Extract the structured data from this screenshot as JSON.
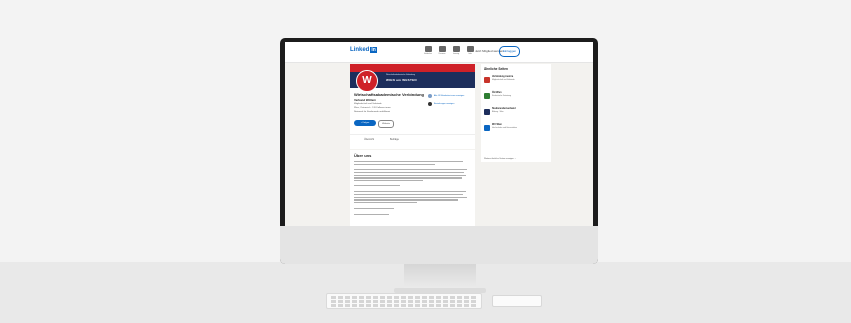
{
  "app": {
    "logo_text": "Linked",
    "logo_in": "in",
    "join_label": "Jetzt Mitglied werden",
    "signin_label": "Einloggen",
    "nav": [
      {
        "label": "Entdecken",
        "icon": "compass-icon"
      },
      {
        "label": "Personen",
        "icon": "people-icon"
      },
      {
        "label": "Learning",
        "icon": "play-icon"
      },
      {
        "label": "Jobs",
        "icon": "briefcase-icon"
      }
    ]
  },
  "company": {
    "banner_top": "Wirtschaftsakademische Verbindung",
    "banner_title": "WIEN am WESTEN",
    "emblem": "W",
    "name": "Wirtschaftsakademische Verbindung",
    "subtitle": "Verband Wöllern",
    "lines": [
      "Mitgliedschaft und Verbände",
      "Wien, Österreich  ·  120 Follower:innen",
      "Netzwerk für Studierende und Alumni"
    ],
    "follow_label": "+ Folgen",
    "visit_label": "Website",
    "side_links": [
      "Alle 13 Mitarbeiter:innen anzeigen",
      "Beziehungen anzeigen"
    ]
  },
  "tabs": [
    "Übersicht",
    "Beiträge"
  ],
  "about": {
    "heading": "Über uns"
  },
  "similar": {
    "heading": "Ähnliche Seiten",
    "items": [
      {
        "name": "Verbindung Austria",
        "sub": "Mitgliedschaft und Verbände",
        "color": "#c8342b"
      },
      {
        "name": "ÖH Wien",
        "sub": "Studentische Vertretung",
        "color": "#2e7d32"
      },
      {
        "name": "Studierendenverband",
        "sub": "Bildung · Wien",
        "color": "#1d2e5c"
      },
      {
        "name": "WU Wien",
        "sub": "Hochschulen und Universitäten",
        "color": "#0a66c2"
      }
    ],
    "more_label": "Weitere ähnliche Seiten anzeigen  ⌄"
  }
}
